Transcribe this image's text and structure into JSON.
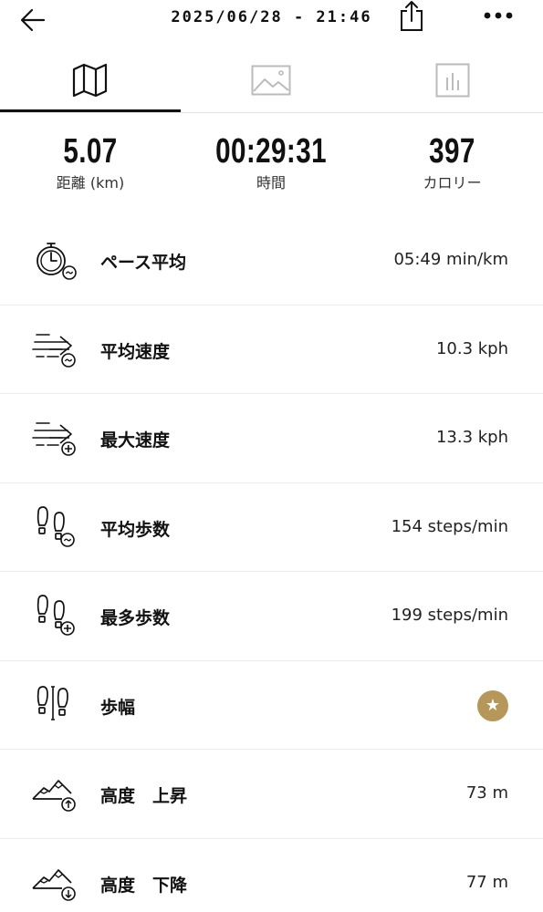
{
  "header": {
    "title": "2025/06/28 - 21:46"
  },
  "tabs": [
    {
      "icon": "map-icon"
    },
    {
      "icon": "image-icon"
    },
    {
      "icon": "chart-icon"
    }
  ],
  "summary": {
    "distance": {
      "value": "5.07",
      "label": "距離 (km)"
    },
    "time": {
      "value": "00:29:31",
      "label": "時間"
    },
    "calories": {
      "value": "397",
      "label": "カロリー"
    }
  },
  "metrics": [
    {
      "label": "ペース平均",
      "value": "05:49 min/km",
      "icon": "stopwatch-icon"
    },
    {
      "label": "平均速度",
      "value": "10.3 kph",
      "icon": "speed-avg-icon"
    },
    {
      "label": "最大速度",
      "value": "13.3 kph",
      "icon": "speed-max-icon"
    },
    {
      "label": "平均歩数",
      "value": "154 steps/min",
      "icon": "steps-avg-icon"
    },
    {
      "label": "最多歩数",
      "value": "199 steps/min",
      "icon": "steps-max-icon"
    },
    {
      "label": "歩幅",
      "value": "★",
      "icon": "stride-icon",
      "badge_color": "#b5975a"
    },
    {
      "label": "高度　上昇",
      "value": "73 m",
      "icon": "elevation-up-icon"
    },
    {
      "label": "高度　下降",
      "value": "77 m",
      "icon": "elevation-down-icon"
    }
  ]
}
